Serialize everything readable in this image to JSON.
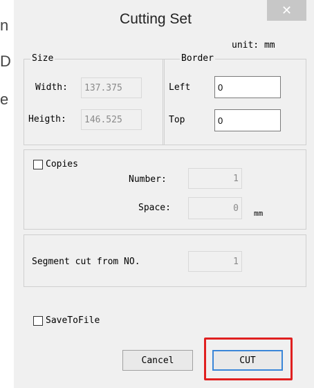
{
  "background": {
    "fragments": [
      "n",
      "D",
      "e"
    ]
  },
  "dialog": {
    "title": "Cutting Set",
    "close_glyph": "✕",
    "unit_label": "unit: mm",
    "size_group": {
      "legend": "Size",
      "width_label": "Width:",
      "width_value": "137.375",
      "height_label": "Heigth:",
      "height_value": "146.525"
    },
    "border_group": {
      "legend": "Border",
      "left_label": "Left",
      "left_value": "0",
      "top_label": "Top",
      "top_value": "0"
    },
    "copies_group": {
      "checkbox_label": "Copies",
      "checked": false,
      "number_label": "Number:",
      "number_value": "1",
      "space_label": "Space:",
      "space_value": "0",
      "space_unit": "mm"
    },
    "segment_group": {
      "label": "Segment cut from NO.",
      "value": "1"
    },
    "save_to_file": {
      "label": "SaveToFile",
      "checked": false
    },
    "buttons": {
      "cancel": "Cancel",
      "cut": "CUT"
    },
    "colors": {
      "highlight": "#e02020",
      "default_button_border": "#3a86d8"
    }
  }
}
